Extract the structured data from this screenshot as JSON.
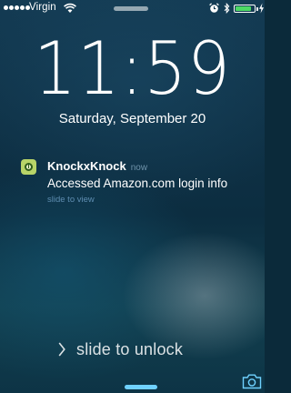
{
  "status_bar": {
    "carrier": "Virgin",
    "signal_strength": 5,
    "battery_level_fraction": 0.85,
    "icons": [
      "wifi-icon",
      "alarm-icon",
      "bluetooth-icon",
      "battery-icon",
      "charging-icon"
    ],
    "battery_color": "#4cd964"
  },
  "lock_screen": {
    "time": "11:59",
    "date": "Saturday, September 20"
  },
  "notification": {
    "app_name": "KnockxKnock",
    "time": "now",
    "message": "Accessed Amazon.com login info",
    "action": "slide to view",
    "icon": "knockxknock-app-icon"
  },
  "unlock": {
    "label": "slide to unlock",
    "icon": "chevron-right-icon"
  },
  "bottom": {
    "home_indicator_color": "#6fd1ff",
    "camera_icon": "camera-icon"
  }
}
